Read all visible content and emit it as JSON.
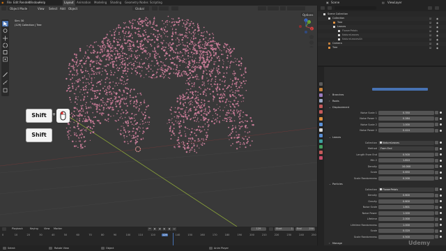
{
  "app": {
    "title": "Blender",
    "menu": [
      "File",
      "Edit",
      "Render",
      "Window",
      "Help"
    ],
    "workspaces": [
      "Layout",
      "Animation",
      "Modeling",
      "Shading",
      "Geometry Nodes",
      "Scripting"
    ],
    "active_workspace": "Layout",
    "scene": "Scene",
    "view_layer": "ViewLayer"
  },
  "viewport": {
    "mode": "Object Mode",
    "menus": [
      "View",
      "Select",
      "Add",
      "Object"
    ],
    "transform": "Global",
    "options_label": "Options",
    "info_line1": "Sim: 30",
    "info_line2": "(129) Collection | Tree",
    "axes": {
      "x": "X",
      "y": "Y",
      "z": "Z"
    }
  },
  "keycast": [
    {
      "key": "Shift",
      "extra": "+"
    },
    {
      "key": "Shift"
    }
  ],
  "outliner": {
    "rows": [
      {
        "label": "Scene Collection",
        "indent": 0
      },
      {
        "label": "Collection",
        "indent": 1
      },
      {
        "label": "Tree",
        "indent": 2
      },
      {
        "label": "Leaves",
        "indent": 2
      },
      {
        "label": "FlowerPetals",
        "indent": 3
      },
      {
        "label": "NatureLeaves",
        "indent": 3
      },
      {
        "label": "NatureLeavesAlt",
        "indent": 3
      },
      {
        "label": "Camera",
        "indent": 1
      },
      {
        "label": "Tree",
        "indent": 1
      }
    ]
  },
  "properties": {
    "sections": {
      "branches": "Branches",
      "roots": "Roots",
      "displacement": "Displacement",
      "leaves": "Leaves",
      "particles": "Particles",
      "manage": "Manage"
    },
    "displacement": [
      {
        "label": "Noise Scale 1",
        "value": "0.350"
      },
      {
        "label": "Noise Power 1",
        "value": "0.284"
      },
      {
        "label": "Noise Scale 2",
        "value": "1.000"
      },
      {
        "label": "Noise Power 2",
        "value": "0.424"
      }
    ],
    "leaves": [
      {
        "label": "Collection",
        "value": "NatureLeaves",
        "kind": "pick"
      },
      {
        "label": "Method",
        "value": "From End",
        "kind": "select"
      },
      {
        "label": "Length From End",
        "value": "0.500"
      },
      {
        "label": "Min 2",
        "value": "1.810"
      },
      {
        "label": "Density",
        "value": "10.000"
      },
      {
        "label": "Scale",
        "value": "0.650"
      },
      {
        "label": "Scale Randomness",
        "value": "0.200"
      }
    ],
    "particles": [
      {
        "label": "Collection",
        "value": "FlowerPetals",
        "kind": "pick"
      },
      {
        "label": "Density",
        "value": "0.600"
      },
      {
        "label": "Gravity",
        "value": "0.600"
      },
      {
        "label": "Noise Scale",
        "value": "1.801"
      },
      {
        "label": "Noise Power",
        "value": "1.000"
      },
      {
        "label": "Lifetime",
        "value": "2.000"
      },
      {
        "label": "Lifetime Randomness",
        "value": "1.000"
      },
      {
        "label": "Scale",
        "value": "0.020"
      },
      {
        "label": "Scale Randomness",
        "value": "0.500"
      }
    ]
  },
  "timeline": {
    "menus": [
      "Playback",
      "Keying",
      "View",
      "Marker"
    ],
    "current_frame": "129",
    "start_label": "Start",
    "start": "1",
    "end_label": "End",
    "end": "250",
    "ticks": [
      "0",
      "10",
      "20",
      "30",
      "40",
      "50",
      "60",
      "70",
      "80",
      "90",
      "100",
      "110",
      "120",
      "129",
      "140",
      "150",
      "160",
      "170",
      "180",
      "190",
      "200",
      "210",
      "220",
      "230",
      "240",
      "250"
    ]
  },
  "statusbar": {
    "left": "Select",
    "mid1": "Rotate View",
    "mid2": "Object",
    "center": "Anim Player",
    "watermark": "Udemy"
  }
}
